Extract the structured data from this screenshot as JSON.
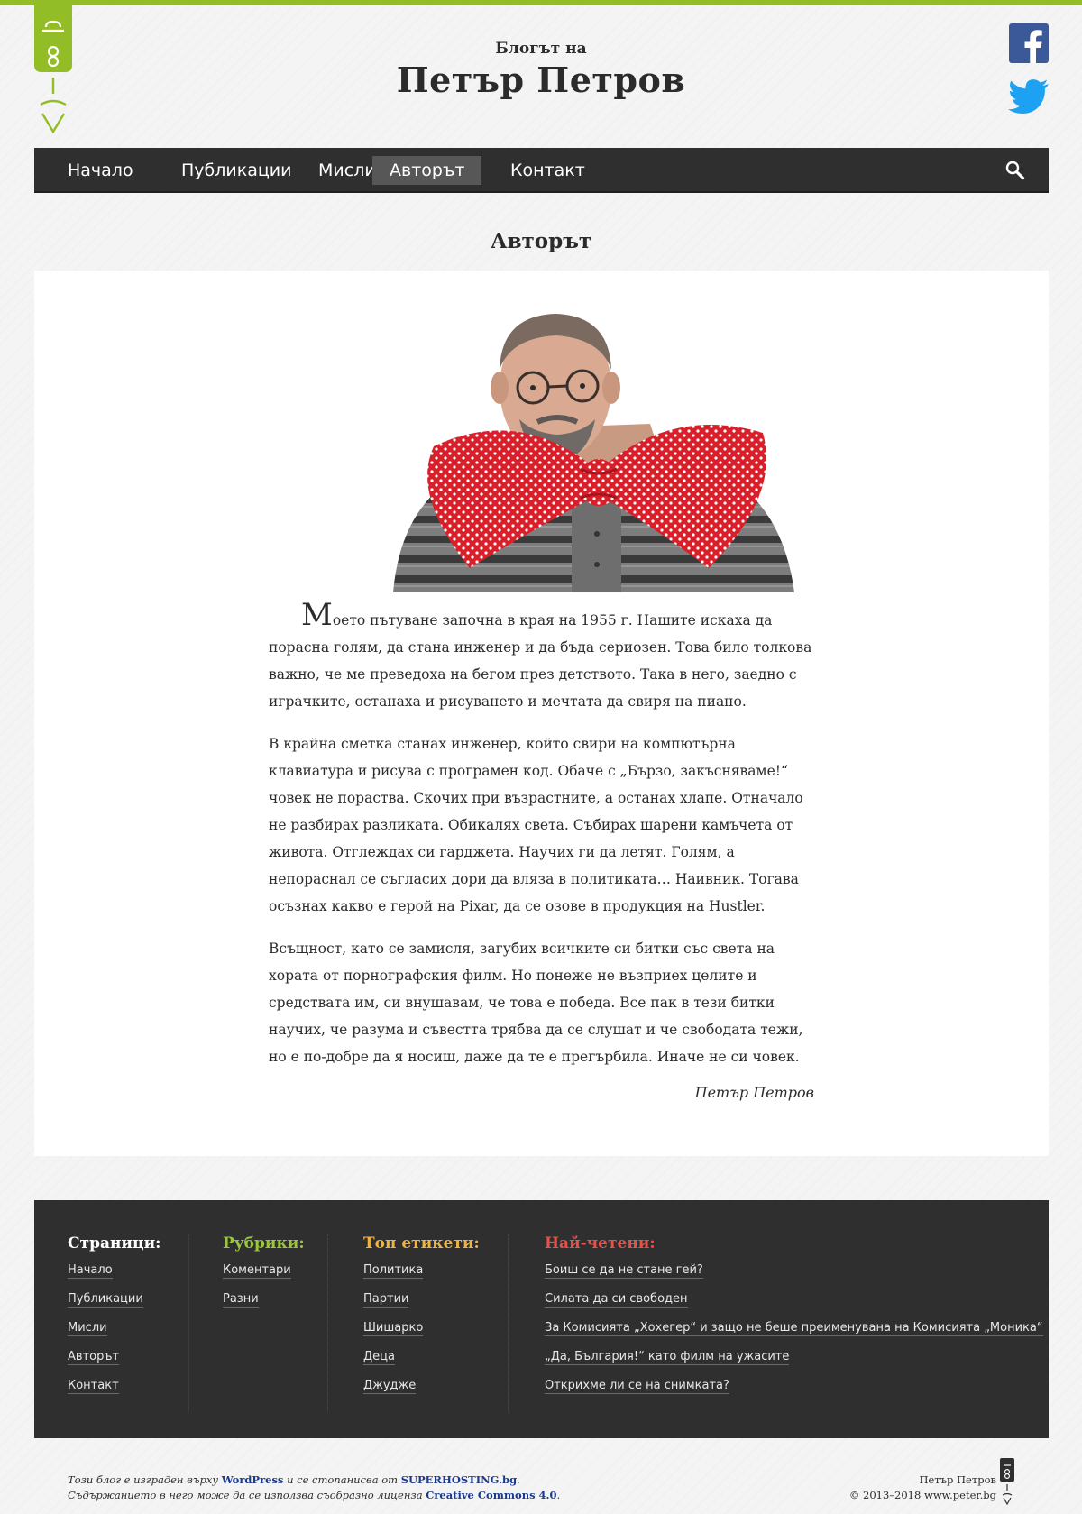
{
  "header": {
    "subtitle": "Блогът на",
    "title": "Петър Петров"
  },
  "social": {
    "facebook_icon": "facebook-icon",
    "twitter_icon": "twitter-icon"
  },
  "nav": {
    "items": [
      {
        "label": "Начало"
      },
      {
        "label": "Публикации"
      },
      {
        "label": "Мисли"
      },
      {
        "label": "Авторът"
      },
      {
        "label": "Контакт"
      }
    ],
    "active": "Авторът",
    "search_icon": "search-icon"
  },
  "page": {
    "title": "Авторът"
  },
  "article": {
    "drop_cap": "М",
    "p1_rest": "оето пътуване започна в края на 1955 г. Нашите искаха да порасна голям, да стана инженер и да бъда сериозен. Това било толкова важно, че ме преведоха на бегом през детството. Така в него, заедно с играчките, останаха и рисуването и мечтата да свиря на пиано.",
    "p2": "В крайна сметка станах инженер, който свири на компютърна клавиатура и рисува с програмен код. Обаче с „Бързо, закъсняваме!“ човек не пораства. Скочих при възрастните, а останах хлапе. Отначало не разбирах разликата. Обикалях света. Събирах шарени камъчета от живота. Отглеждах си гарджета. Научих ги да летят. Голям, а непораснал се съгласих дори да вляза в политиката… Наивник. Тогава осъзнах какво е герой на Pixar, да се озове в продукция на Hustler.",
    "p3": "Всъщност, като се замисля, загубих всичките си битки със света на хората от порнографския филм. Но понеже не възприех целите и средствата им, си внушавам, че това е победа. Все пак в тези битки научих, че разума и съвестта трябва да се слушат и че свободата тежи, но е по-добре да я носиш, даже да те е прегърбила. Иначе не си човек.",
    "signature": "Петър Петров"
  },
  "footer": {
    "pages": {
      "heading": "Страници:",
      "color": "#ffffff",
      "links": [
        "Начало",
        "Публикации",
        "Мисли",
        "Авторът",
        "Контакт"
      ]
    },
    "categories": {
      "heading": "Рубрики:",
      "color": "#9bc53d",
      "links": [
        "Коментари",
        "Разни"
      ]
    },
    "tags": {
      "heading": "Топ етикети:",
      "color": "#f0b43c",
      "links": [
        "Политика",
        "Партии",
        "Шишарко",
        "Деца",
        "Джудже"
      ]
    },
    "popular": {
      "heading": "Най-четени:",
      "color": "#e8504a",
      "links": [
        "Боиш се да не стане гей?",
        "Силата да си свободен",
        "За Комисията „Хохегер“ и защо не беше преименувана на Комисията „Моника“",
        "„Да, България!“ като филм на ужасите",
        "Открихме ли се на снимката?"
      ]
    }
  },
  "bottom": {
    "line1_pre": "Този блог е изграден върху ",
    "line1_link1": "WordPress",
    "line1_mid": " и се стопанисва от ",
    "line1_link2": "SUPERHOSTING.bg",
    "line1_post": ".",
    "line2_pre": "Съдържанието в него може да се използва съобразно лиценза ",
    "line2_link": "Creative Commons 4.0",
    "line2_post": ".",
    "author": "Петър Петров",
    "copyright": "© 2013–2018 www.peter.bg"
  },
  "colors": {
    "accent": "#93bd27",
    "nav_bg": "#2f2f2f",
    "link_blue": "#1a3a8f"
  }
}
